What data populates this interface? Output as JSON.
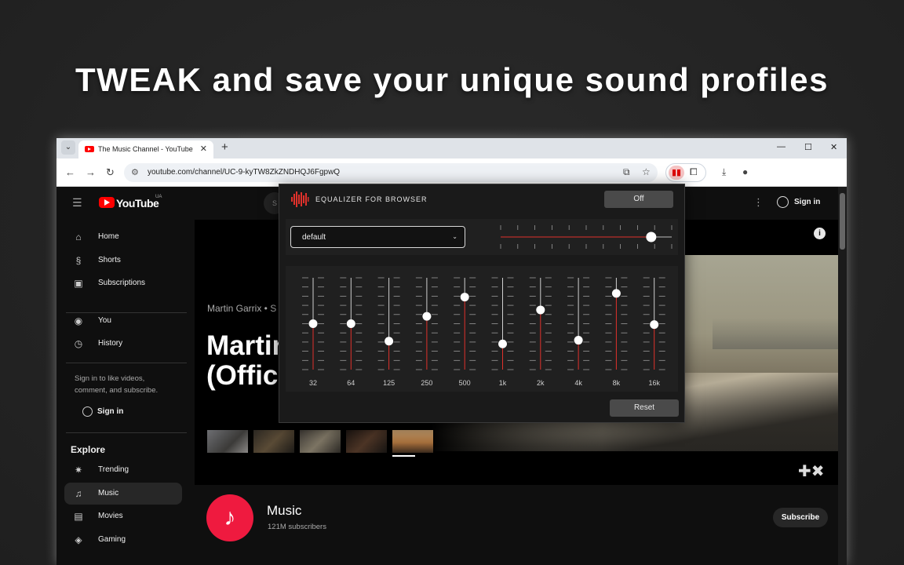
{
  "headline": "TWEAK and save your unique sound profiles",
  "browser": {
    "tab_title": "The Music Channel - YouTube",
    "url": "youtube.com/channel/UC-9-kyTW8ZkZNDHQJ6FgpwQ"
  },
  "youtube": {
    "logo_text": "YouTube",
    "country_code": "UA",
    "search_hint": "S",
    "nav": [
      {
        "label": "Home",
        "icon": "home-icon"
      },
      {
        "label": "Shorts",
        "icon": "shorts-icon"
      },
      {
        "label": "Subscriptions",
        "icon": "subscriptions-icon"
      },
      {
        "label": "You",
        "icon": "you-icon"
      },
      {
        "label": "History",
        "icon": "history-icon"
      }
    ],
    "signin_hint": "Sign in to like videos, comment, and subscribe.",
    "sidebar_signin": "Sign in",
    "explore_title": "Explore",
    "explore": [
      {
        "label": "Trending",
        "icon": "trending-icon",
        "active": false
      },
      {
        "label": "Music",
        "icon": "music-icon",
        "active": true
      },
      {
        "label": "Movies",
        "icon": "movies-icon",
        "active": false
      },
      {
        "label": "Gaming",
        "icon": "gaming-icon",
        "active": false
      }
    ],
    "top_signin": "Sign in",
    "banner": {
      "artist_line": "Martin Garrix • S",
      "title": "Martir\n(Offici"
    },
    "channel": {
      "name": "Music",
      "subscribers": "121M subscribers",
      "subscribe_label": "Subscribe"
    }
  },
  "equalizer": {
    "title": "EQUALIZER FOR BROWSER",
    "power_label": "Off",
    "preset": "default",
    "volume_level": 0.88,
    "bands": [
      {
        "freq": "32",
        "level": 0.5
      },
      {
        "freq": "64",
        "level": 0.5
      },
      {
        "freq": "125",
        "level": 0.31
      },
      {
        "freq": "250",
        "level": 0.58
      },
      {
        "freq": "500",
        "level": 0.79
      },
      {
        "freq": "1k",
        "level": 0.28
      },
      {
        "freq": "2k",
        "level": 0.65
      },
      {
        "freq": "4k",
        "level": 0.32
      },
      {
        "freq": "8k",
        "level": 0.83
      },
      {
        "freq": "16k",
        "level": 0.49
      }
    ],
    "reset_label": "Reset",
    "accent_color": "#e0312b"
  }
}
